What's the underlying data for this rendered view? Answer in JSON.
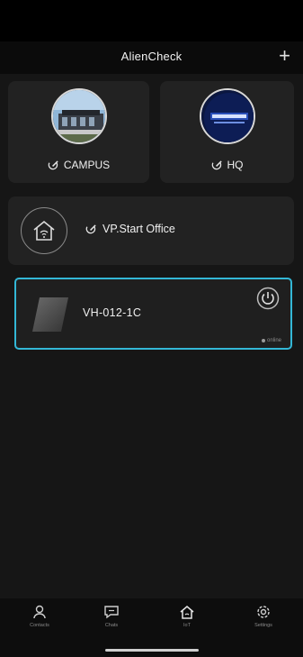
{
  "header": {
    "title": "AlienCheck",
    "add_label": "+"
  },
  "sites": [
    {
      "name": "CAMPUS"
    },
    {
      "name": "HQ"
    }
  ],
  "office": {
    "name": "VP.Start Office"
  },
  "device": {
    "name": "VH-012-1C",
    "status": "online"
  },
  "tabs": [
    {
      "label": "Contacts",
      "icon": "contacts-icon"
    },
    {
      "label": "Chats",
      "icon": "chat-icon"
    },
    {
      "label": "IoT",
      "icon": "home-icon"
    },
    {
      "label": "Settings",
      "icon": "gear-icon"
    }
  ],
  "colors": {
    "accent": "#33b7d6",
    "background": "#161616",
    "card": "#222222"
  }
}
